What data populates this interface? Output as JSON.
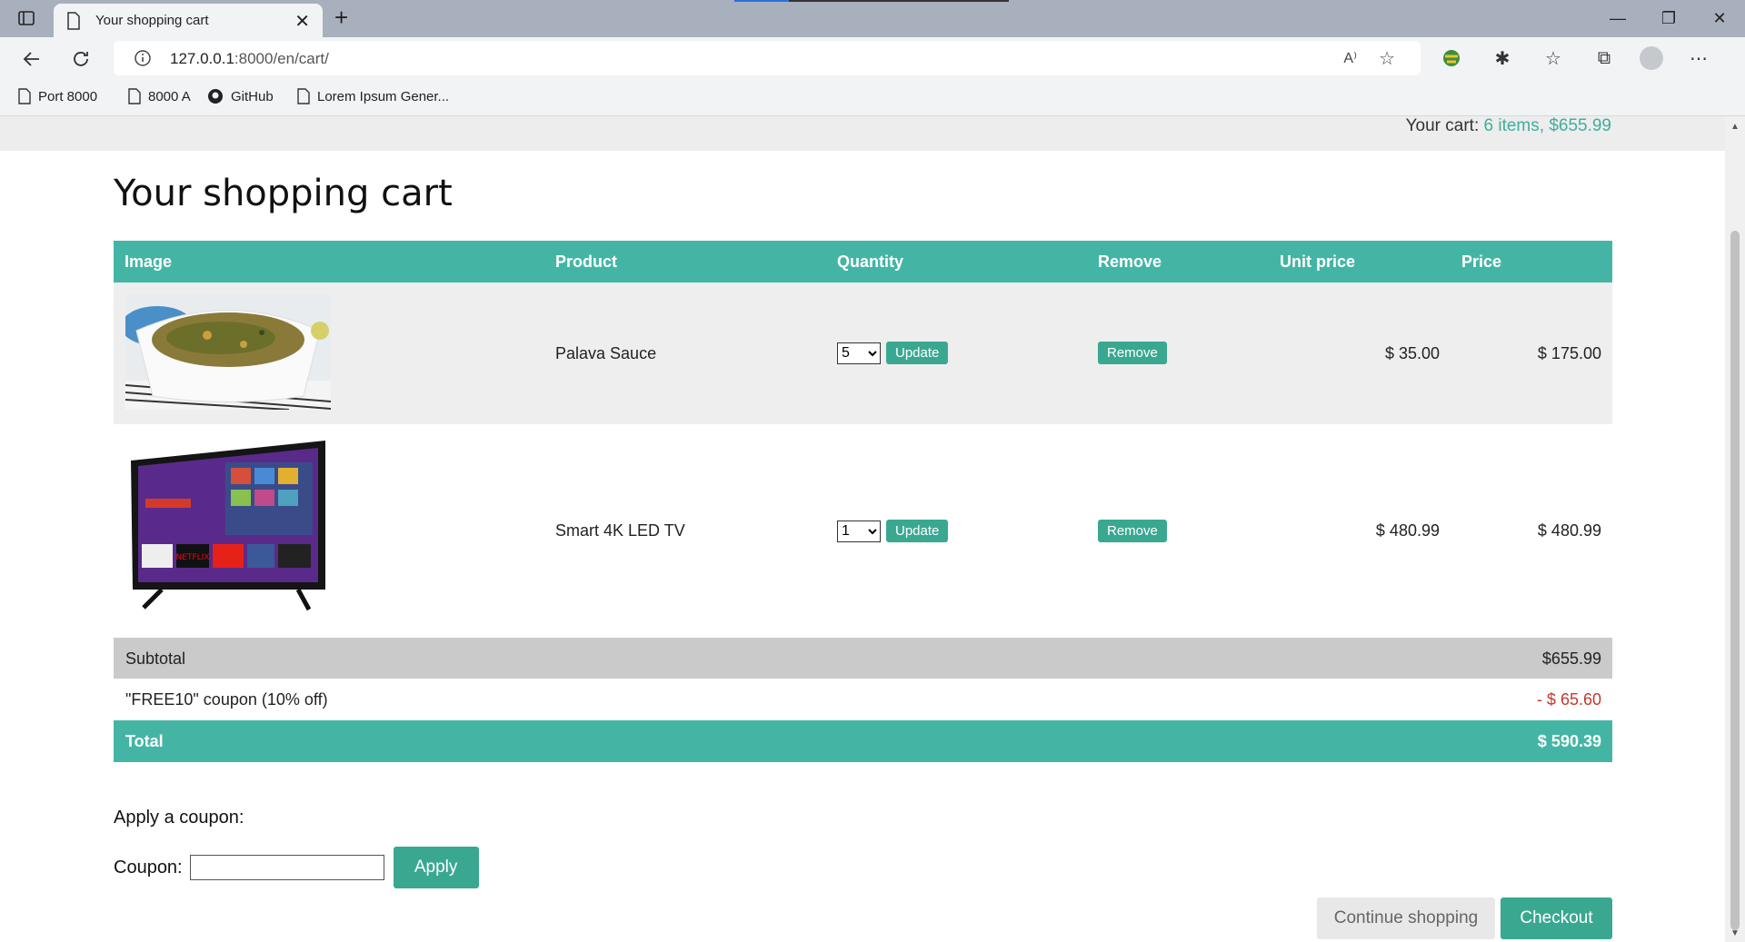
{
  "browser": {
    "tab_title": "Your shopping cart",
    "url_host": "127.0.0.1",
    "url_rest": ":8000/en/cart/",
    "read_aloud": "A⁾",
    "bookmarks": [
      "Port 8000",
      "8000 A",
      "GitHub",
      "Lorem Ipsum Gener..."
    ]
  },
  "header": {
    "cart_label": "Your cart:",
    "cart_summary": "6 items, $655.99"
  },
  "page": {
    "title": "Your shopping cart"
  },
  "table": {
    "columns": [
      "Image",
      "Product",
      "Quantity",
      "Remove",
      "Unit price",
      "Price"
    ],
    "rows": [
      {
        "product": "Palava Sauce",
        "quantity": "5",
        "update_label": "Update",
        "remove_label": "Remove",
        "unit_price": "$ 35.00",
        "price": "$ 175.00"
      },
      {
        "product": "Smart 4K LED TV",
        "quantity": "1",
        "update_label": "Update",
        "remove_label": "Remove",
        "unit_price": "$ 480.99",
        "price": "$ 480.99"
      }
    ],
    "subtotal_label": "Subtotal",
    "subtotal_value": "$655.99",
    "coupon_label": "\"FREE10\" coupon (10% off)",
    "coupon_value": "- $ 65.60",
    "total_label": "Total",
    "total_value": "$ 590.39"
  },
  "coupon_form": {
    "title": "Apply a coupon:",
    "label": "Coupon:",
    "value": "",
    "apply_label": "Apply"
  },
  "actions": {
    "continue_label": "Continue shopping",
    "checkout_label": "Checkout"
  },
  "colors": {
    "accent": "#44b5a5",
    "button": "#3aa891",
    "negative": "#c0392b"
  }
}
